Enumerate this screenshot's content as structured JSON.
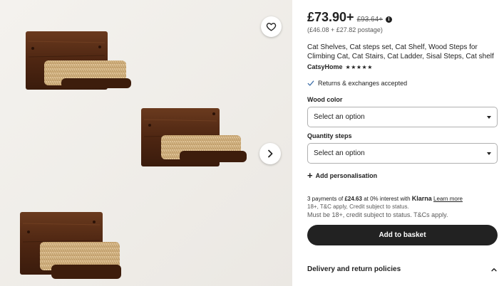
{
  "listing": {
    "price": "£73.90+",
    "original_price": "£93.64+",
    "price_breakdown": "(£46.08 + £27.82 postage)",
    "title": "Cat Shelves, Cat steps set, Cat Shelf, Wood Steps for Climbing Cat, Cat Stairs, Cat Ladder, Sisal Steps, Cat shelf",
    "seller": "CatsyHome",
    "rating_stars": "★★★★★",
    "returns": "Returns & exchanges accepted"
  },
  "options": {
    "wood_color": {
      "label": "Wood color",
      "value": "Select an option"
    },
    "quantity_steps": {
      "label": "Quantity steps",
      "value": "Select an option"
    }
  },
  "personalisation": {
    "label": "Add personalisation"
  },
  "payment": {
    "installments_prefix": "3 payments of",
    "installment_amount": "£24.63",
    "installments_suffix": "at 0% interest with",
    "provider": "Klarna",
    "learn_more": "Learn more",
    "terms": "18+, T&C apply, Credit subject to status.",
    "age_notice": "Must be 18+, credit subject to status. T&Cs apply."
  },
  "actions": {
    "add_to_basket": "Add to basket"
  },
  "delivery": {
    "label": "Delivery and return policies"
  },
  "icons": {
    "favorite": "heart-icon",
    "next": "chevron-right-icon",
    "info": "info-icon",
    "check": "check-icon",
    "plus": "plus-icon",
    "caret": "caret-down-icon",
    "collapse": "chevron-up-icon"
  },
  "colors": {
    "primary_button": "#222222",
    "check_accent": "#3d6ea8",
    "image_background": "#f2f0ec",
    "wood": "#5a2d17",
    "sisal": "#d8bb8e"
  }
}
